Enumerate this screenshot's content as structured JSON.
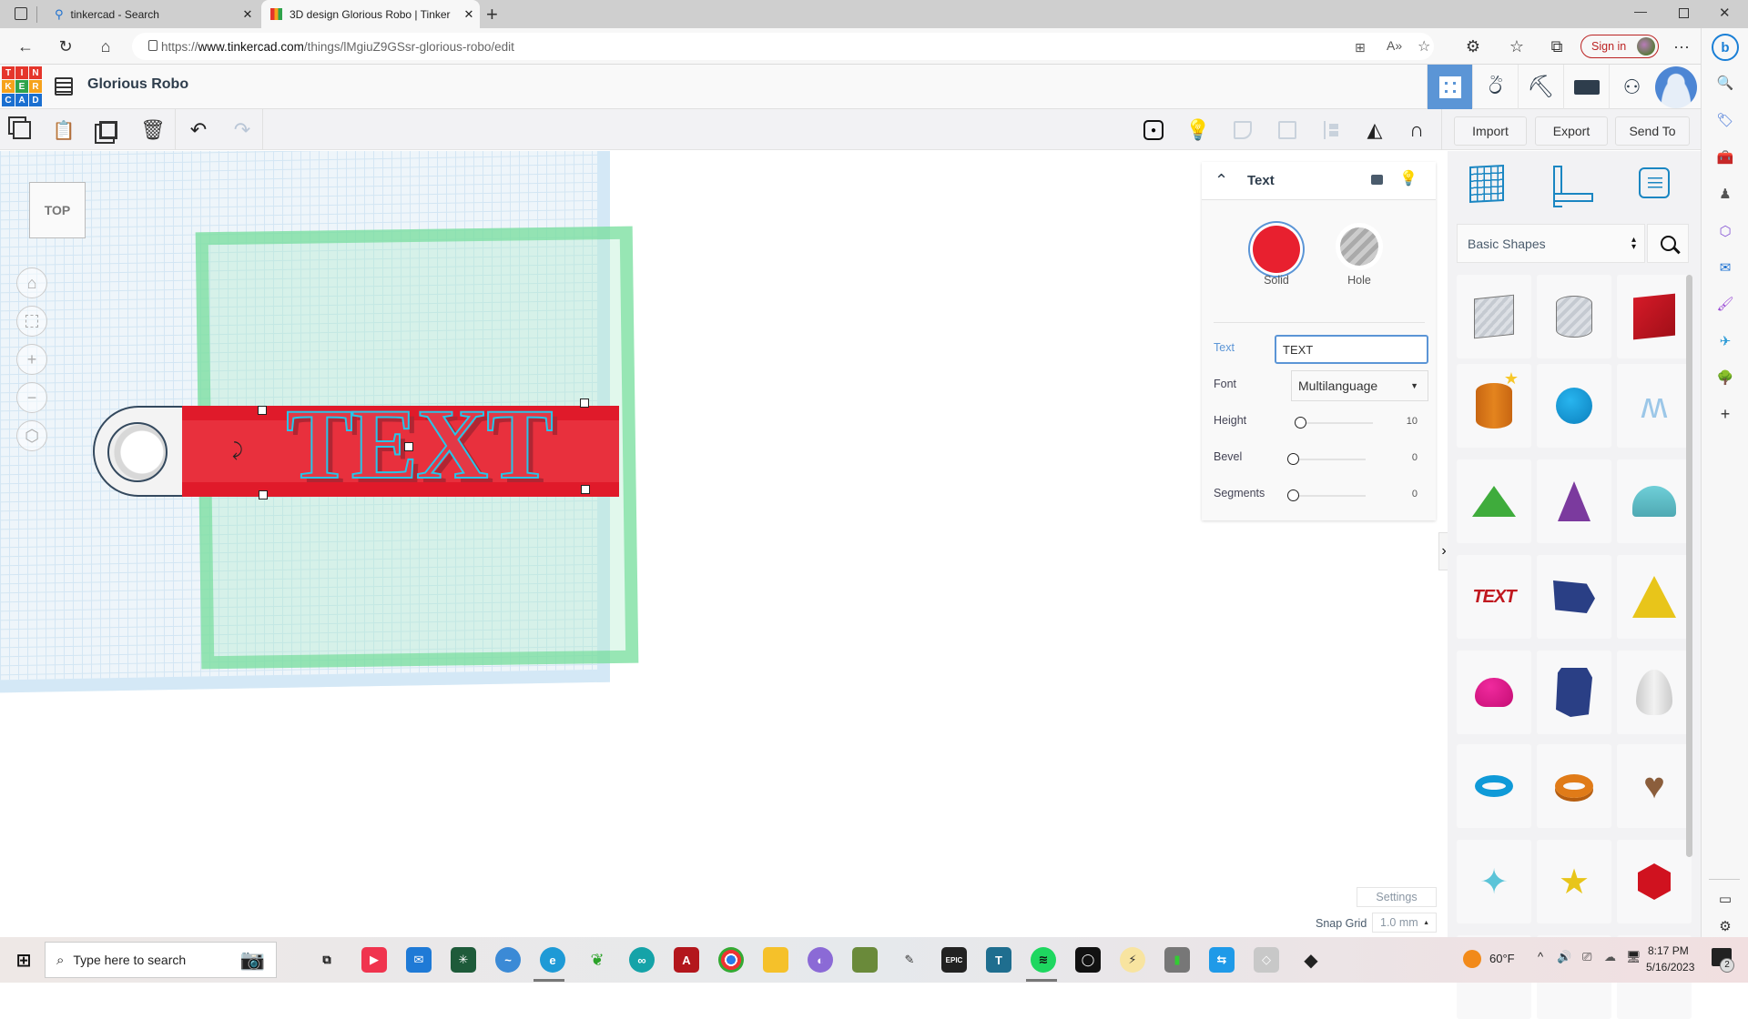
{
  "browser": {
    "tabs": [
      {
        "title": "tinkercad - Search",
        "icon": "search-icon",
        "active": false
      },
      {
        "title": "3D design Glorious Robo | Tinker",
        "icon": "tinkercad-favicon",
        "active": true
      }
    ],
    "url_prefix": "https://",
    "url_domain": "www.tinkercad.com",
    "url_path": "/things/lMgiuZ9GSsr-glorious-robo/edit",
    "signin_label": "Sign in",
    "more_label": "···"
  },
  "app": {
    "logo_letters": [
      "T",
      "I",
      "N",
      "K",
      "E",
      "R",
      "C",
      "A",
      "D"
    ],
    "design_title": "Glorious Robo",
    "header_buttons": [
      "grid-view-icon",
      "tinker-lab-icon",
      "minecraft-pickaxe-icon",
      "brick-icon",
      "add-user-icon",
      "user-avatar"
    ]
  },
  "toolbar": {
    "left_tools": [
      "copy-icon",
      "paste-icon",
      "duplicate-icon",
      "delete-icon",
      "undo-icon",
      "redo-icon"
    ],
    "right_tools": [
      "notes-icon",
      "lightbulb-icon",
      "group-icon",
      "ungroup-icon",
      "align-icon",
      "mirror-icon",
      "cruise-icon"
    ],
    "import_label": "Import",
    "export_label": "Export",
    "sendto_label": "Send To"
  },
  "canvas": {
    "viewcube_label": "TOP",
    "nav_controls": [
      "home-view-icon",
      "fit-view-icon",
      "zoom-in-icon",
      "zoom-out-icon",
      "perspective-icon"
    ],
    "selected_text": "TEXT"
  },
  "inspector": {
    "title": "Text",
    "solid_label": "Solid",
    "hole_label": "Hole",
    "solid_color": "#e8202f",
    "text_label": "Text",
    "text_value": "TEXT",
    "font_label": "Font",
    "font_value": "Multilanguage",
    "height_label": "Height",
    "height_value": "10",
    "bevel_label": "Bevel",
    "bevel_value": "0",
    "segments_label": "Segments",
    "segments_value": "0"
  },
  "shapes_panel": {
    "category": "Basic Shapes",
    "tabs": [
      "workplane-icon",
      "ruler-icon",
      "notes-icon"
    ],
    "shapes": [
      {
        "name": "box-hole",
        "color": "#c0c5cc"
      },
      {
        "name": "cylinder-hole",
        "color": "#c0c5cc"
      },
      {
        "name": "box",
        "color": "#d0121f"
      },
      {
        "name": "cylinder",
        "color": "#e07b18"
      },
      {
        "name": "sphere",
        "color": "#0f9ad8"
      },
      {
        "name": "scribble",
        "color": "#9cc7e8"
      },
      {
        "name": "roof",
        "color": "#3fac3c"
      },
      {
        "name": "cone",
        "color": "#7b3a9e"
      },
      {
        "name": "round-roof",
        "color": "#5fc4cf"
      },
      {
        "name": "text",
        "color": "#c0181f"
      },
      {
        "name": "wedge",
        "color": "#2a3f85"
      },
      {
        "name": "pyramid",
        "color": "#e8c51a"
      },
      {
        "name": "half-sphere",
        "color": "#e0108a"
      },
      {
        "name": "polygon",
        "color": "#2a3f85"
      },
      {
        "name": "paraboloid",
        "color": "#dcdcdc"
      },
      {
        "name": "torus",
        "color": "#0f9ad8"
      },
      {
        "name": "tube",
        "color": "#e07b18"
      },
      {
        "name": "heart",
        "color": "#8b5e3c"
      },
      {
        "name": "star-pointed",
        "color": "#5cc4d8"
      },
      {
        "name": "star",
        "color": "#e8c51a"
      },
      {
        "name": "icosahedron",
        "color": "#d0121f"
      }
    ],
    "settings_label": "Settings",
    "snap_grid_label": "Snap Grid",
    "snap_grid_value": "1.0 mm"
  },
  "taskbar": {
    "search_placeholder": "Type here to search",
    "weather": "60°F",
    "time": "8:17 PM",
    "date": "5/16/2023",
    "notification_count": "2"
  }
}
